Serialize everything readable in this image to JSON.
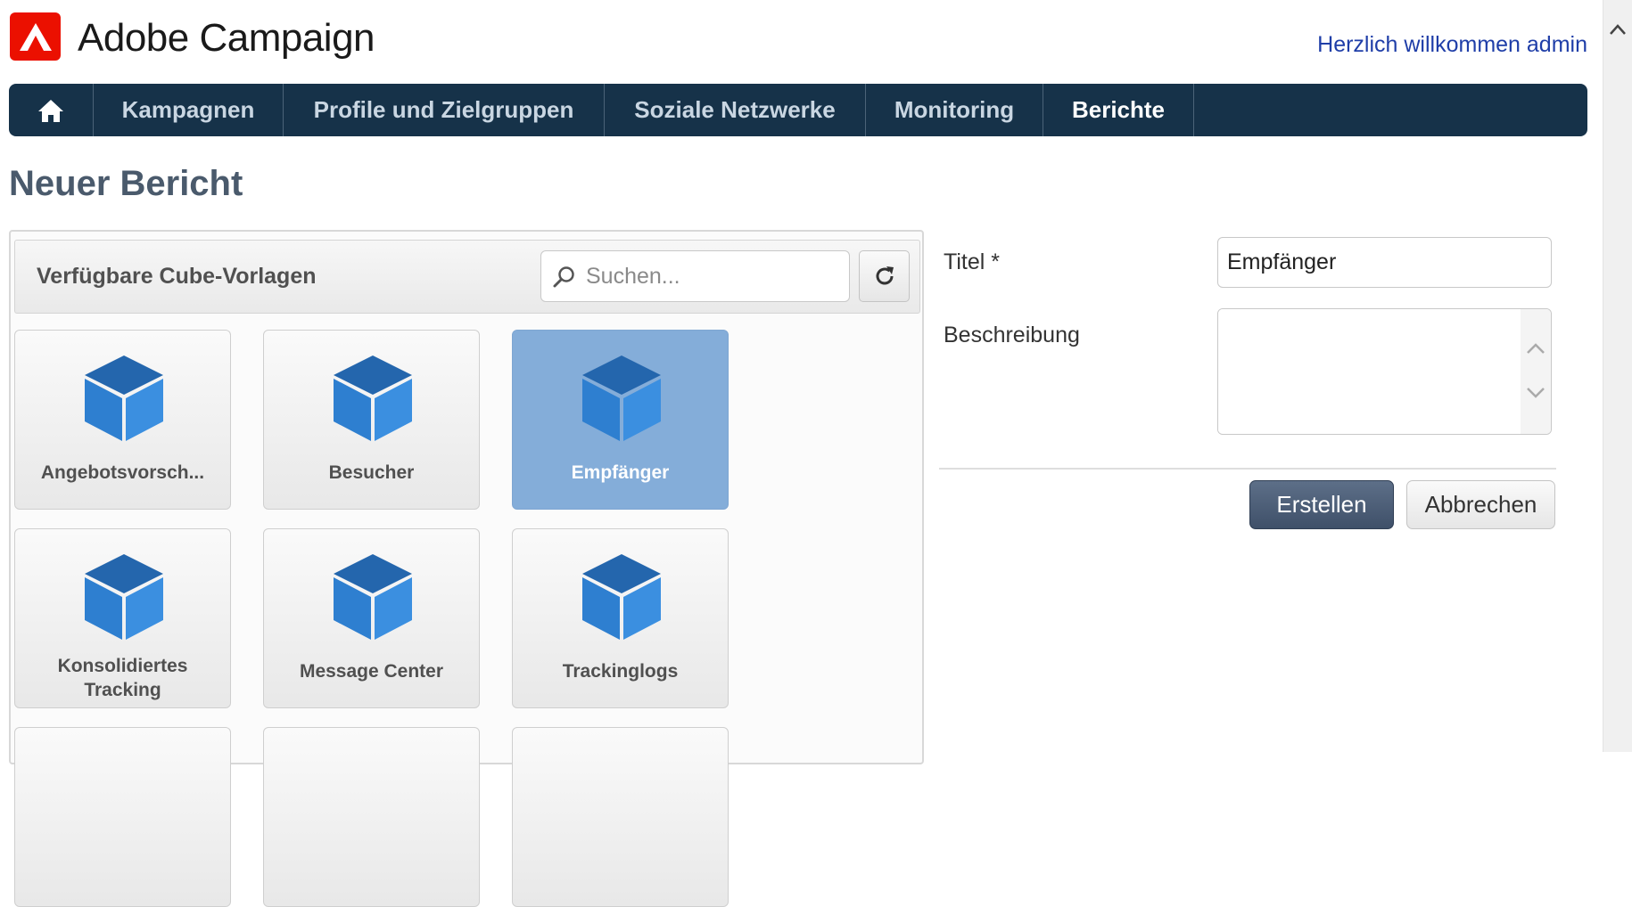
{
  "app": {
    "brand": "Adobe Campaign",
    "welcome": "Herzlich willkommen admin",
    "logo_color": "#eb1000"
  },
  "nav": {
    "home_icon": "home-icon",
    "items": [
      {
        "label": "Kampagnen",
        "active": false
      },
      {
        "label": "Profile und Zielgruppen",
        "active": false
      },
      {
        "label": "Soziale Netzwerke",
        "active": false
      },
      {
        "label": "Monitoring",
        "active": false
      },
      {
        "label": "Berichte",
        "active": true
      }
    ],
    "bar_color": "#163249"
  },
  "page": {
    "title": "Neuer Bericht"
  },
  "templates": {
    "panel_title": "Verfügbare Cube-Vorlagen",
    "search_placeholder": "Suchen...",
    "search_value": "",
    "refresh_icon": "refresh-icon",
    "cube_color": "#2f80d0",
    "selected_color": "#84add9",
    "tiles": [
      {
        "label": "Angebotsvorsch...",
        "selected": false
      },
      {
        "label": "Besucher",
        "selected": false
      },
      {
        "label": "Empfänger",
        "selected": true
      },
      {
        "label": "Konsolidiertes Tracking",
        "selected": false
      },
      {
        "label": "Message Center",
        "selected": false
      },
      {
        "label": "Trackinglogs",
        "selected": false
      }
    ]
  },
  "form": {
    "title_label": "Titel *",
    "title_value": "Empfänger",
    "description_label": "Beschreibung",
    "description_value": "",
    "create_label": "Erstellen",
    "cancel_label": "Abbrechen"
  }
}
